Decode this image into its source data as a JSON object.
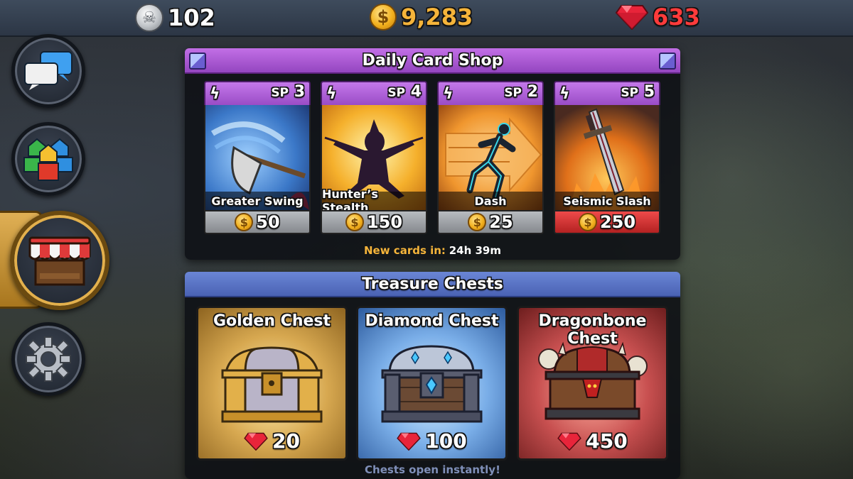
{
  "topbar": {
    "silver": "102",
    "gold": "9,283",
    "gems": "633"
  },
  "shop": {
    "title": "Daily Card Shop",
    "cards": [
      {
        "name": "Greater Swing",
        "sp_label": "SP",
        "sp_value": "3",
        "price": "50",
        "price_style": "gray"
      },
      {
        "name": "Hunter’s Stealth",
        "sp_label": "SP",
        "sp_value": "4",
        "price": "150",
        "price_style": "gray"
      },
      {
        "name": "Dash",
        "sp_label": "SP",
        "sp_value": "2",
        "price": "25",
        "price_style": "gray"
      },
      {
        "name": "Seismic Slash",
        "sp_label": "SP",
        "sp_value": "5",
        "price": "250",
        "price_style": "red"
      }
    ],
    "new_cards_label": "New cards in:",
    "new_cards_time": "24h 39m"
  },
  "chests": {
    "title": "Treasure Chests",
    "items": [
      {
        "name": "Golden Chest",
        "price": "20"
      },
      {
        "name": "Diamond Chest",
        "price": "100"
      },
      {
        "name": "Dragonbone Chest",
        "price": "450"
      }
    ],
    "note": "Chests open instantly!"
  },
  "colors": {
    "gold_text": "#f5b43a",
    "gem_text": "#ff3b3b",
    "shop_header": "#b15ed8",
    "chest_header": "#5a74c6"
  }
}
